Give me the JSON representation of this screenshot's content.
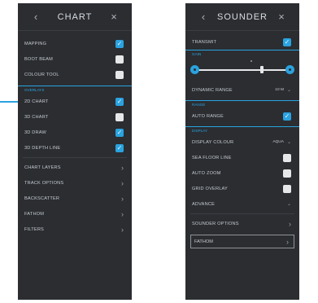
{
  "colors": {
    "accent": "#2aa3e0",
    "panel_bg": "#2b2d31"
  },
  "icons": {
    "back": "‹",
    "close": "×",
    "chevron": "›",
    "check": "✓",
    "down": "⌄"
  },
  "chart_panel": {
    "title": "CHART",
    "toggles": [
      {
        "label": "MAPPING",
        "checked": true
      },
      {
        "label": "BOOT BEAM",
        "checked": false
      },
      {
        "label": "COLOUR TOOL",
        "checked": false
      }
    ],
    "section_label": "OVERLAYS",
    "overlay_toggles": [
      {
        "label": "2D CHART",
        "checked": true
      },
      {
        "label": "3D CHART",
        "checked": false
      },
      {
        "label": "3D DRAW",
        "checked": true
      },
      {
        "label": "3D DEPTH LINE",
        "checked": true
      }
    ],
    "nav_items": [
      {
        "label": "CHART LAYERS"
      },
      {
        "label": "TRACK OPTIONS"
      },
      {
        "label": "BACKSCATTER"
      },
      {
        "label": "FATHOM"
      },
      {
        "label": "FILTERS"
      }
    ]
  },
  "sounder_panel": {
    "title": "SOUNDER",
    "top_toggle": {
      "label": "TRANSMIT",
      "checked": true
    },
    "section_gain": "GAIN",
    "dynamic_range": {
      "label": "DYNAMIC RANGE",
      "value": "10 M"
    },
    "section_range": "RANGE",
    "auto_range": {
      "label": "AUTO RANGE",
      "checked": true
    },
    "section_display": "DISPLAY",
    "display_colour": {
      "label": "DISPLAY COLOUR",
      "value": "AQUA"
    },
    "display_toggles": [
      {
        "label": "SEA FLOOR LINE",
        "checked": false
      },
      {
        "label": "AUTO ZOOM",
        "checked": false
      },
      {
        "label": "GRID OVERLAY",
        "checked": false
      }
    ],
    "advance": {
      "label": "ADVANCE"
    },
    "nav_items": [
      {
        "label": "SOUNDER OPTIONS"
      },
      {
        "label": "FATHOM"
      }
    ]
  }
}
